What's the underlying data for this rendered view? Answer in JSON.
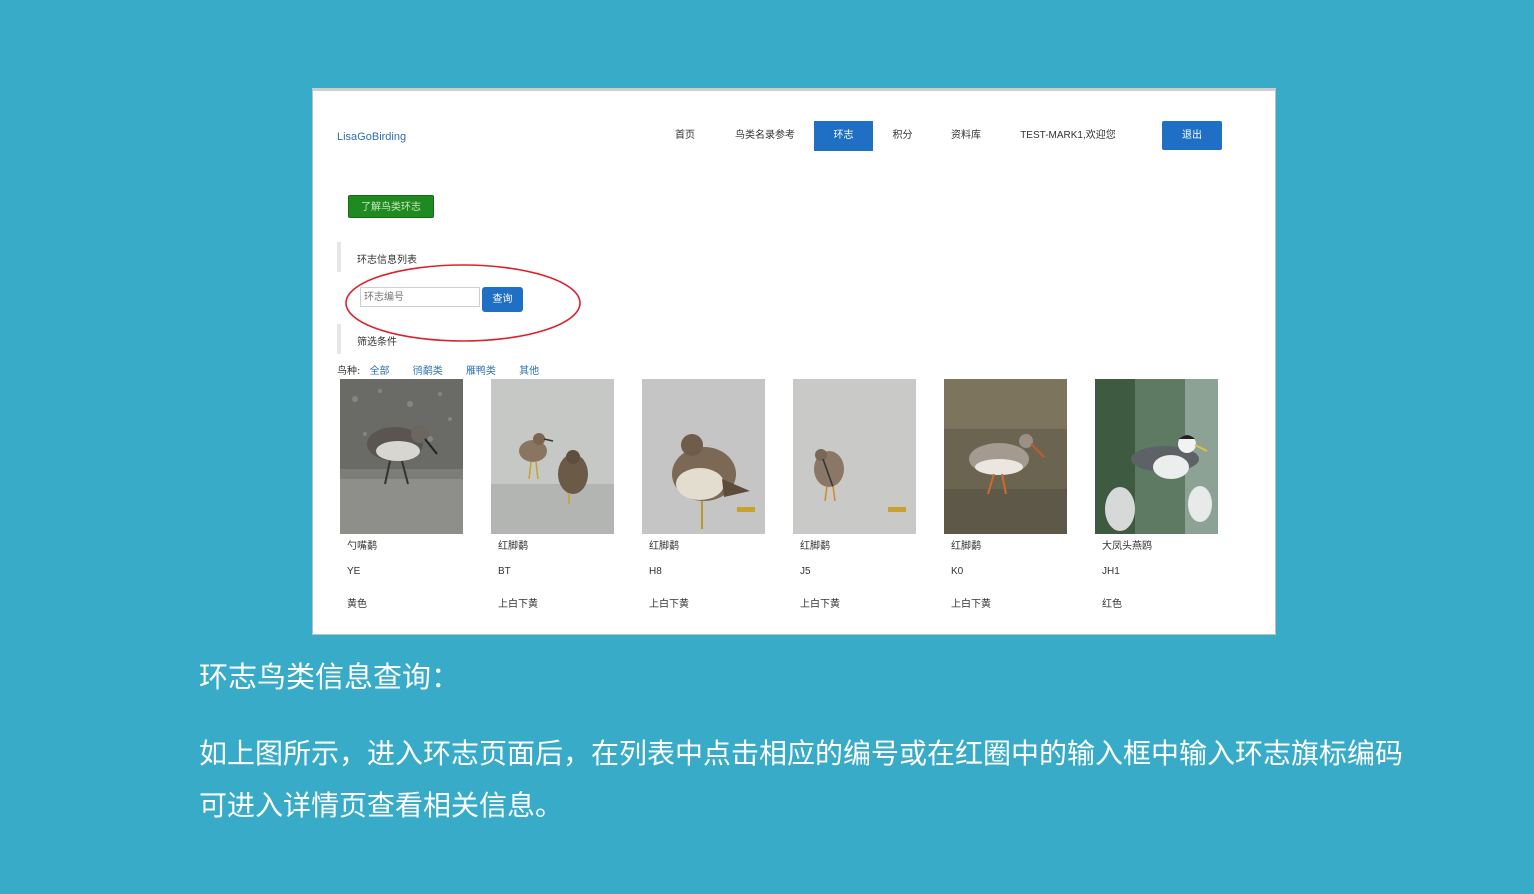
{
  "theme": {
    "background": "#37abc8",
    "primary": "#1f6fc5",
    "link": "#2f6fb6",
    "green": "#1f8a1f",
    "highlight_circle": "#d9232d"
  },
  "site": {
    "brand": "LisaGoBirding",
    "nav": [
      "首页",
      "鸟类名录参考",
      "环志",
      "积分",
      "资料库",
      "TEST-MARK1,欢迎您"
    ],
    "active_nav": "环志",
    "logout_label": "退出"
  },
  "page": {
    "learn_button": "了解鸟类环志",
    "list_title": "环志信息列表",
    "search": {
      "placeholder": "环志编号",
      "button": "查询"
    },
    "filter_title": "筛选条件",
    "filter": {
      "label": "鸟种:",
      "options": [
        "全部",
        "鸻鹬类",
        "雁鸭类",
        "其他"
      ]
    },
    "birds": [
      {
        "name": "勺嘴鹬",
        "code": "YE",
        "color": "黄色",
        "image": "bird-photo"
      },
      {
        "name": "红脚鹬",
        "code": "BT",
        "color": "上白下黄",
        "image": "bird-photo"
      },
      {
        "name": "红脚鹬",
        "code": "H8",
        "color": "上白下黄",
        "image": "bird-photo"
      },
      {
        "name": "红脚鹬",
        "code": "J5",
        "color": "上白下黄",
        "image": "bird-photo"
      },
      {
        "name": "红脚鹬",
        "code": "K0",
        "color": "上白下黄",
        "image": "bird-photo"
      },
      {
        "name": "大凤头燕鸥",
        "code": "JH1",
        "color": "红色",
        "image": "bird-photo"
      }
    ]
  },
  "caption": {
    "title": "环志鸟类信息查询：",
    "body": "如上图所示，进入环志页面后，在列表中点击相应的编号或在红圈中的输入框中输入环志旗标编码可进入详情页查看相关信息。"
  }
}
